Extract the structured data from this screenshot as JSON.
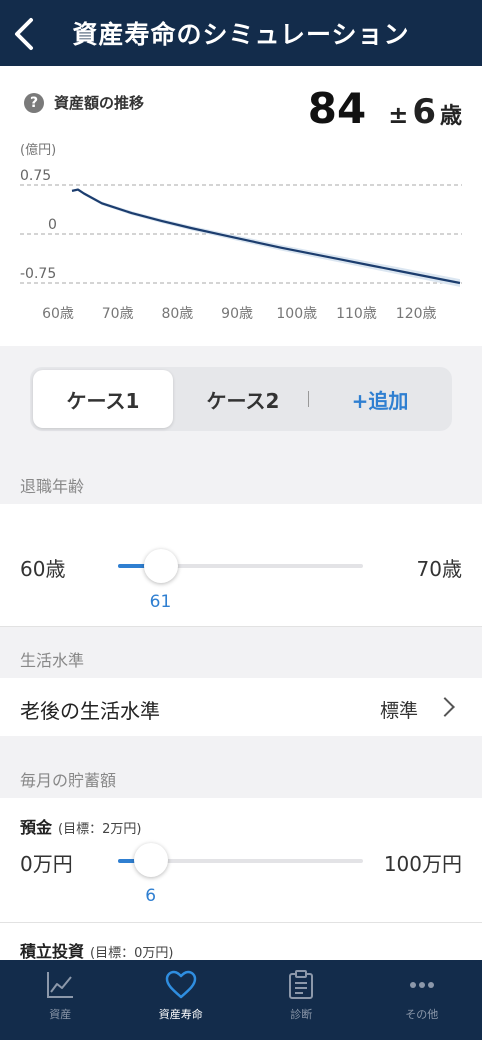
{
  "header": {
    "title": "資産寿命のシミュレーション"
  },
  "summary": {
    "label": "資産額の推移",
    "age": "84",
    "pm": "±",
    "range": "6",
    "unit": "歳"
  },
  "chart_data": {
    "type": "line",
    "ylabel": "(億円)",
    "yticks": [
      0.75,
      0,
      -0.75
    ],
    "ytick_labels": [
      "0.75",
      "0",
      "-0.75"
    ],
    "ylim": [
      -0.85,
      0.85
    ],
    "xticks": [
      60,
      70,
      80,
      90,
      100,
      110,
      120
    ],
    "xtick_labels": [
      "60歳",
      "70歳",
      "80歳",
      "90歳",
      "100歳",
      "110歳",
      "120歳"
    ],
    "xlim": [
      60,
      125
    ],
    "series": [
      {
        "x": [
          60,
          61,
          62,
          65,
          70,
          75,
          80,
          85,
          90,
          95,
          100,
          105,
          110,
          115,
          120,
          125
        ],
        "y": [
          0.66,
          0.68,
          0.62,
          0.47,
          0.32,
          0.2,
          0.09,
          -0.01,
          -0.11,
          -0.21,
          -0.3,
          -0.39,
          -0.48,
          -0.57,
          -0.66,
          -0.75
        ]
      }
    ],
    "band_width": 0.06,
    "grid": "dashed-horizontal",
    "colors": {
      "line": "#1c3d6e",
      "band": "#dbe6f1"
    }
  },
  "tabs": [
    {
      "label": "ケース1",
      "active": true
    },
    {
      "label": "ケース2",
      "active": false
    },
    {
      "label": "+追加",
      "active": false
    }
  ],
  "retirement": {
    "section_label": "退職年齢",
    "min_label": "60歳",
    "max_label": "70歳",
    "value": "61",
    "fraction": 0.1
  },
  "living": {
    "section_label": "生活水準",
    "row_title": "老後の生活水準",
    "row_value": "標準"
  },
  "savings": {
    "section_label": "毎月の貯蓄額",
    "deposit": {
      "title": "預金",
      "goal": "(目標：2万円)",
      "min_label": "0万円",
      "max_label": "100万円",
      "value": "6",
      "fraction": 0.06
    },
    "investment": {
      "title": "積立投資",
      "goal": "(目標：0万円)"
    }
  },
  "nav": [
    {
      "label": "資産",
      "icon": "chart-icon",
      "active": false
    },
    {
      "label": "資産寿命",
      "icon": "heart-icon",
      "active": true
    },
    {
      "label": "診断",
      "icon": "clipboard-icon",
      "active": false
    },
    {
      "label": "その他",
      "icon": "more-icon",
      "active": false
    }
  ],
  "colors": {
    "header": "#132c4b",
    "accent": "#2f7fd1"
  }
}
